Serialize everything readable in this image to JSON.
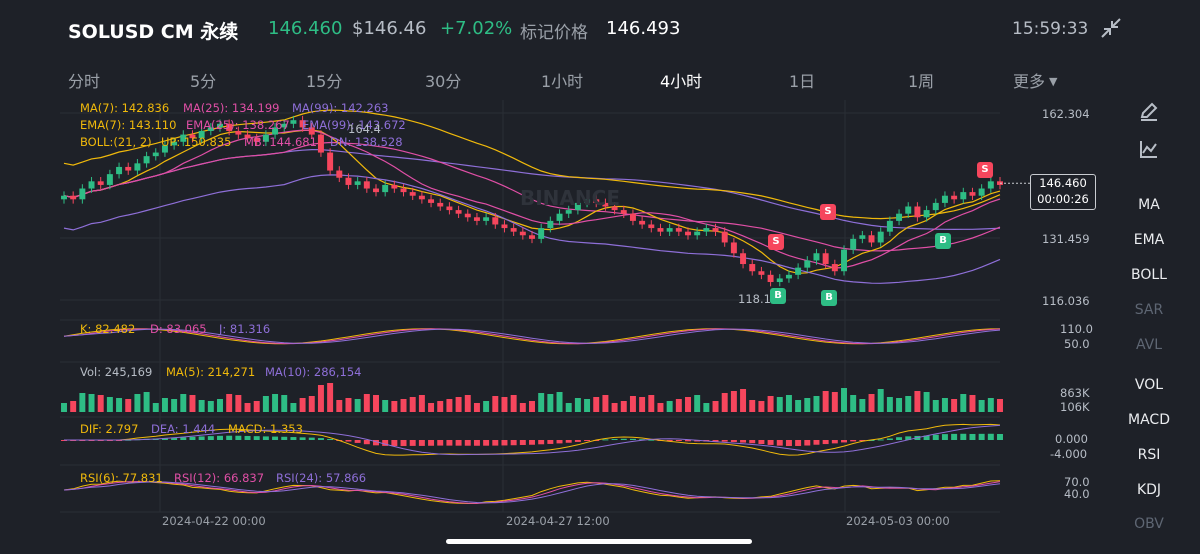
{
  "header": {
    "title": "SOLUSD CM 永续",
    "last_price": "146.460",
    "usd_price": "$146.46",
    "change": "+7.02%",
    "mark_label": "标记价格",
    "mark_price": "146.493",
    "time": "15:59:33",
    "collapse_icon": "collapse-arrows-icon"
  },
  "tabs": [
    {
      "label": "分时"
    },
    {
      "label": "5分"
    },
    {
      "label": "15分"
    },
    {
      "label": "30分"
    },
    {
      "label": "1小时"
    },
    {
      "label": "4小时",
      "active": true
    },
    {
      "label": "1日"
    },
    {
      "label": "1周"
    },
    {
      "label": "更多"
    }
  ],
  "indicators": {
    "ma": {
      "ma7": "MA(7): 142.836",
      "ma25": "MA(25): 134.199",
      "ma99": "MA(99): 142.263"
    },
    "ema": {
      "ema7": "EMA(7): 143.110",
      "ema25": "EMA(25): 138.267",
      "ema99": "EMA(99): 143.672"
    },
    "boll": {
      "params": "BOLL:(21, 2)",
      "up": "UP: 150.835",
      "mb": "MB: 144.681",
      "dn": "DN: 138.528"
    },
    "kdj": {
      "k": "K: 82.482",
      "d": "D: 83.065",
      "j": "J: 81.316"
    },
    "vol": {
      "vol": "Vol: 245,169",
      "ma5": "MA(5): 214,271",
      "ma10": "MA(10): 286,154"
    },
    "macd": {
      "dif": "DIF: 2.797",
      "dea": "DEA: 1.444",
      "macd": "MACD: 1.353"
    },
    "rsi": {
      "rsi6": "RSI(6): 77.831",
      "rsi12": "RSI(12): 66.837",
      "rsi24": "RSI(24): 57.866"
    }
  },
  "axes": {
    "price": [
      "162.304",
      "131.459",
      "116.036"
    ],
    "kdj": [
      "110.0",
      "50.0"
    ],
    "vol": [
      "863K",
      "106K"
    ],
    "macd": [
      "0.000",
      "-4.000"
    ],
    "rsi": [
      "70.0",
      "40.0"
    ]
  },
  "annotations": {
    "high": "164.4",
    "low": "118.13",
    "watermark": "BINANCE"
  },
  "current_price_box": {
    "price": "146.460",
    "countdown": "00:00:26"
  },
  "dates": [
    "2024-04-22 00:00",
    "2024-04-27 12:00",
    "2024-05-03 00:00"
  ],
  "signals": {
    "sell": "S",
    "buy": "B"
  },
  "right_panel": {
    "tool_icons": [
      "pencil-icon",
      "chart-line-icon"
    ],
    "items": [
      {
        "label": "MA",
        "dim": false
      },
      {
        "label": "EMA",
        "dim": false
      },
      {
        "label": "BOLL",
        "dim": false
      },
      {
        "label": "SAR",
        "dim": true
      },
      {
        "label": "AVL",
        "dim": true
      },
      {
        "label": "VOL",
        "dim": false
      },
      {
        "label": "MACD",
        "dim": false
      },
      {
        "label": "RSI",
        "dim": false
      },
      {
        "label": "KDJ",
        "dim": false
      },
      {
        "label": "OBV",
        "dim": true
      }
    ]
  },
  "colors": {
    "up": "#2ebd85",
    "down": "#f6465d",
    "ma7": "#f0b90b",
    "ma25": "#e04fa6",
    "ma99": "#8e6fd8",
    "background": "#1e2128"
  },
  "chart_data": {
    "type": "candlestick",
    "interval": "4小时",
    "price_axis_ticks": [
      162.304,
      131.459,
      116.036
    ],
    "close_approx": [
      143,
      142,
      145,
      147,
      146,
      149,
      151,
      150,
      152,
      154,
      155,
      157,
      158,
      160,
      159,
      161,
      162,
      163,
      161,
      160,
      159,
      158,
      160,
      162,
      163,
      164,
      162,
      160,
      155,
      150,
      148,
      146,
      147,
      145,
      144,
      146,
      145,
      144,
      143,
      142,
      141,
      140,
      139,
      138,
      137,
      136,
      137,
      135,
      134,
      133,
      132,
      131,
      134,
      136,
      138,
      139,
      141,
      142,
      141,
      140,
      139,
      138,
      136,
      135,
      134,
      133,
      134,
      133,
      132,
      133,
      134,
      133,
      130,
      127,
      124,
      122,
      121,
      119,
      120,
      121,
      123,
      125,
      127,
      124,
      122,
      128,
      131,
      132,
      130,
      133,
      136,
      138,
      140,
      137,
      139,
      141,
      143,
      142,
      144,
      143,
      145,
      147,
      146
    ],
    "current_price": 146.46,
    "annotated_high": 164.4,
    "annotated_low": 118.13
  }
}
